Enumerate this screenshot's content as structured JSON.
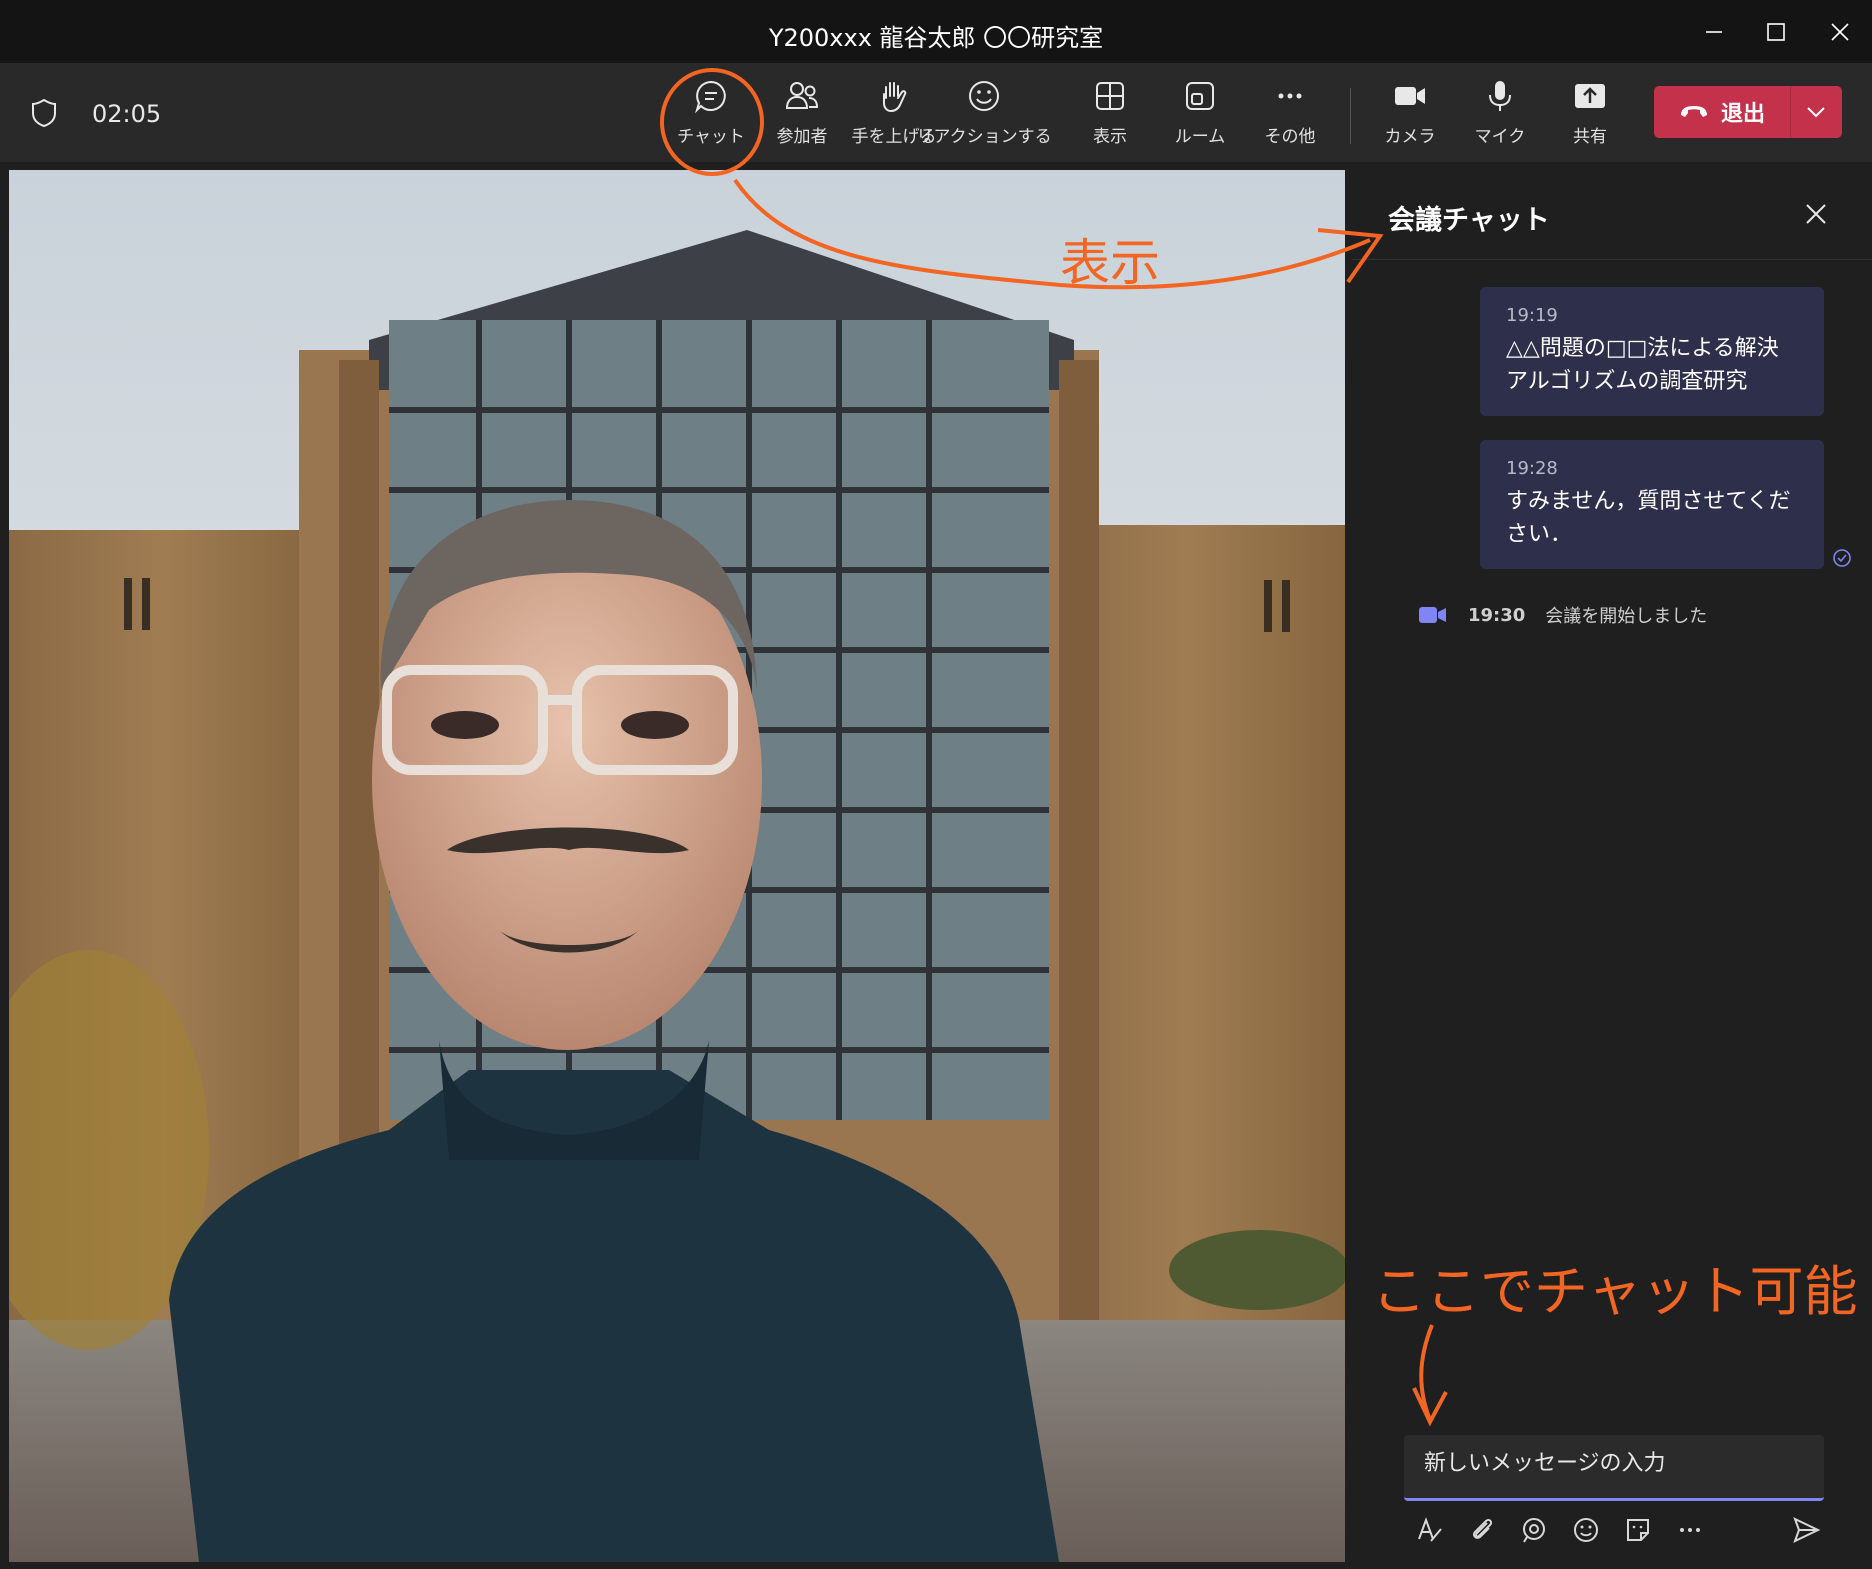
{
  "window": {
    "title": "Y200xxx 龍谷太郎 〇〇研究室"
  },
  "toolbar": {
    "timer": "02:05",
    "buttons": [
      {
        "label": "チャット",
        "icon": "chat-icon"
      },
      {
        "label": "参加者",
        "icon": "participants-icon"
      },
      {
        "label": "手を上げる",
        "icon": "raise-hand-icon"
      },
      {
        "label": "リアクションする",
        "icon": "reaction-icon"
      },
      {
        "label": "表示",
        "icon": "view-icon"
      },
      {
        "label": "ルーム",
        "icon": "room-icon"
      },
      {
        "label": "その他",
        "icon": "more-icon"
      },
      {
        "label": "カメラ",
        "icon": "camera-icon"
      },
      {
        "label": "マイク",
        "icon": "mic-icon"
      },
      {
        "label": "共有",
        "icon": "share-icon"
      }
    ],
    "leave_label": "退出",
    "leave_color": "#c4314b"
  },
  "chat": {
    "title": "会議チャット",
    "messages": [
      {
        "time": "19:19",
        "text": "△△問題の□□法による解決アルゴリズムの調査研究"
      },
      {
        "time": "19:28",
        "text": "すみません，質問させてください．"
      }
    ],
    "system": {
      "time": "19:30",
      "text": "会議を開始しました"
    },
    "compose_placeholder": "新しいメッセージの入力",
    "accent_color": "#7f85f5"
  },
  "annotations": {
    "display_note": "表示",
    "chat_note": "ここでチャット可能",
    "color": "#f26522"
  }
}
